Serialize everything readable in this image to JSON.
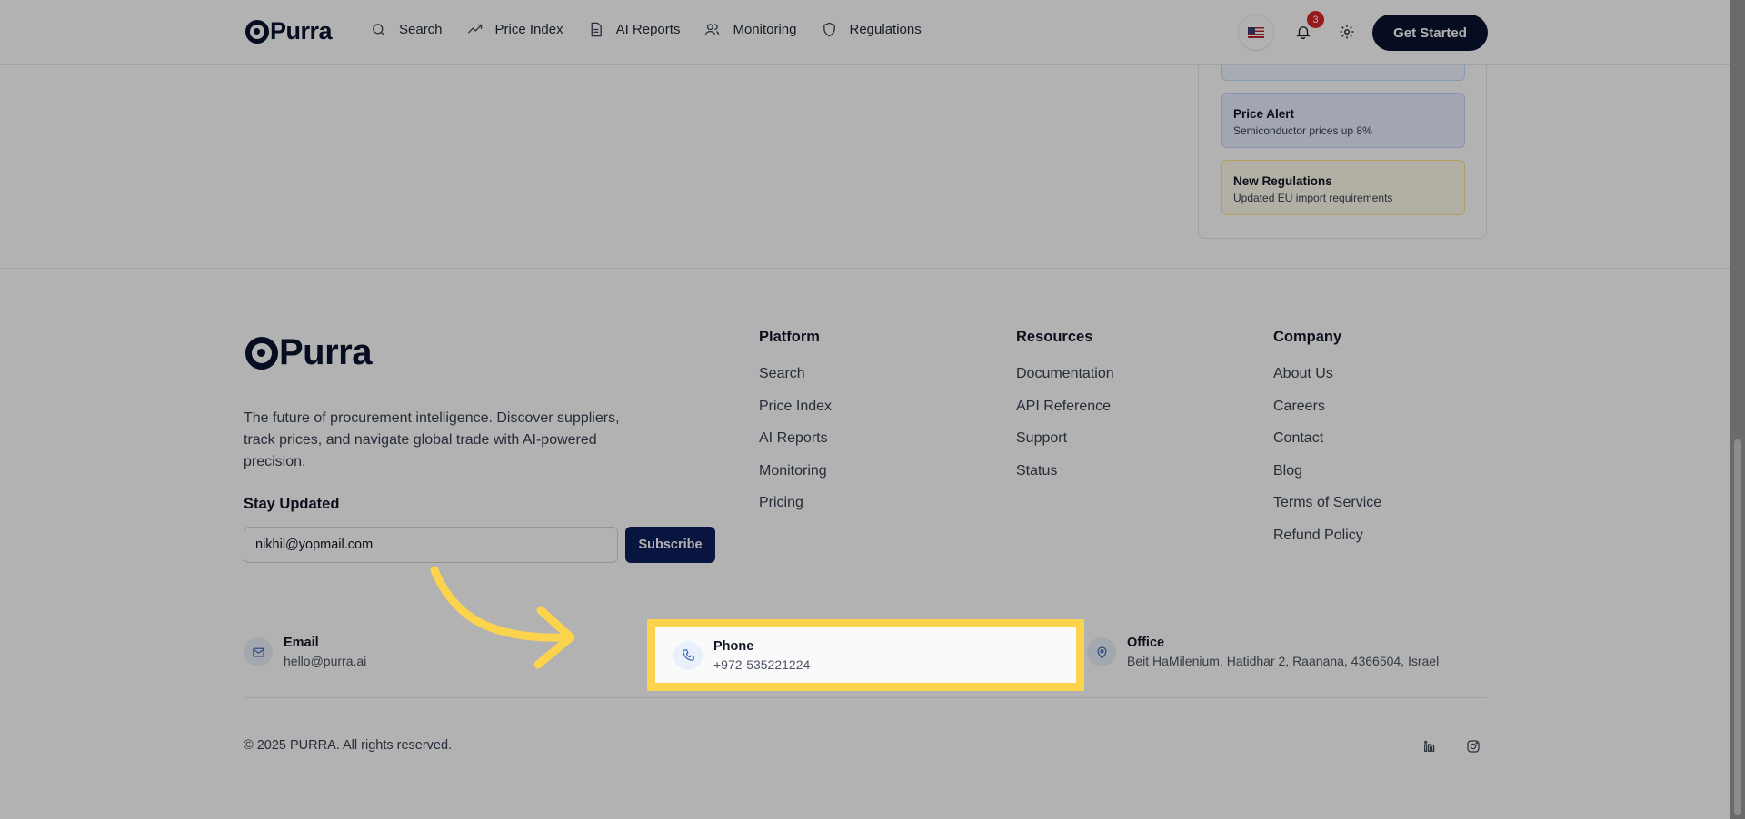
{
  "header": {
    "logo_text": "Purra",
    "nav": [
      {
        "label": "Search",
        "icon": "search-icon"
      },
      {
        "label": "Price Index",
        "icon": "trending-up-icon"
      },
      {
        "label": "AI Reports",
        "icon": "document-icon"
      },
      {
        "label": "Monitoring",
        "icon": "users-icon"
      },
      {
        "label": "Regulations",
        "icon": "shield-icon"
      }
    ],
    "notification_count": "3",
    "cta_label": "Get Started"
  },
  "alerts": [
    {
      "title": "Price Alert",
      "desc": "Semiconductor prices up 8%"
    },
    {
      "title": "New Regulations",
      "desc": "Updated EU import requirements"
    }
  ],
  "footer": {
    "logo_text": "Purra",
    "description": "The future of procurement intelligence. Discover suppliers, track prices, and navigate global trade with AI-powered precision.",
    "stay_updated": "Stay Updated",
    "email_value": "nikhil@yopmail.com",
    "subscribe_label": "Subscribe",
    "columns": [
      {
        "title": "Platform",
        "links": [
          "Search",
          "Price Index",
          "AI Reports",
          "Monitoring",
          "Pricing"
        ]
      },
      {
        "title": "Resources",
        "links": [
          "Documentation",
          "API Reference",
          "Support",
          "Status"
        ]
      },
      {
        "title": "Company",
        "links": [
          "About Us",
          "Careers",
          "Contact",
          "Blog",
          "Terms of Service",
          "Refund Policy"
        ]
      }
    ],
    "contact": {
      "email": {
        "label": "Email",
        "value": "hello@purra.ai"
      },
      "phone": {
        "label": "Phone",
        "value": "+972-535221224"
      },
      "office": {
        "label": "Office",
        "value": "Beit HaMilenium, Hatidhar 2, Raanana, 4366504, Israel"
      }
    },
    "copyright": "© 2025 PURRA. All rights reserved."
  },
  "colors": {
    "brand": "#0b1430",
    "highlight": "#fcd34d"
  }
}
